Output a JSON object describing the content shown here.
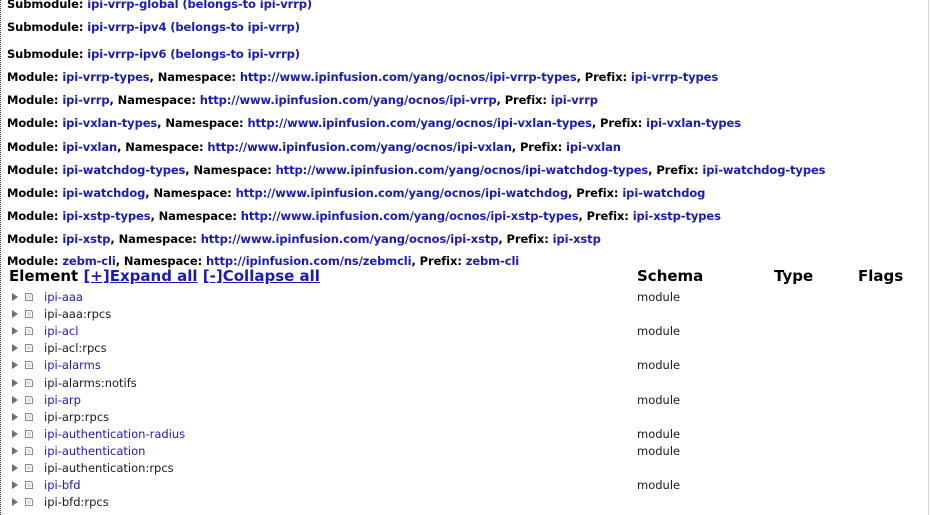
{
  "module_lines": [
    {
      "k1": "Submodule: ",
      "v1": "ipi-vrrp-global (belongs-to ipi-vrrp)"
    },
    {
      "k1": "Submodule: ",
      "v1": "ipi-vrrp-ipv4 (belongs-to ipi-vrrp)"
    },
    {
      "k1": "Submodule: ",
      "v1": "ipi-vrrp-ipv6 (belongs-to ipi-vrrp)"
    },
    {
      "k1": "Module: ",
      "v1": "ipi-vrrp-types",
      "k2": ", Namespace: ",
      "v2": "http://www.ipinfusion.com/yang/ocnos/ipi-vrrp-types",
      "k3": ", Prefix: ",
      "v3": "ipi-vrrp-types"
    },
    {
      "k1": "Module: ",
      "v1": "ipi-vrrp",
      "k2": ", Namespace: ",
      "v2": "http://www.ipinfusion.com/yang/ocnos/ipi-vrrp",
      "k3": ", Prefix: ",
      "v3": "ipi-vrrp"
    },
    {
      "k1": "Module: ",
      "v1": "ipi-vxlan-types",
      "k2": ", Namespace: ",
      "v2": "http://www.ipinfusion.com/yang/ocnos/ipi-vxlan-types",
      "k3": ", Prefix: ",
      "v3": "ipi-vxlan-types"
    },
    {
      "k1": "Module: ",
      "v1": "ipi-vxlan",
      "k2": ", Namespace: ",
      "v2": "http://www.ipinfusion.com/yang/ocnos/ipi-vxlan",
      "k3": ", Prefix: ",
      "v3": "ipi-vxlan"
    },
    {
      "k1": "Module: ",
      "v1": "ipi-watchdog-types",
      "k2": ", Namespace: ",
      "v2": "http://www.ipinfusion.com/yang/ocnos/ipi-watchdog-types",
      "k3": ", Prefix: ",
      "v3": "ipi-watchdog-types"
    },
    {
      "k1": "Module: ",
      "v1": "ipi-watchdog",
      "k2": ", Namespace: ",
      "v2": "http://www.ipinfusion.com/yang/ocnos/ipi-watchdog",
      "k3": ", Prefix: ",
      "v3": "ipi-watchdog"
    },
    {
      "k1": "Module: ",
      "v1": "ipi-xstp-types",
      "k2": ", Namespace: ",
      "v2": "http://www.ipinfusion.com/yang/ocnos/ipi-xstp-types",
      "k3": ", Prefix: ",
      "v3": "ipi-xstp-types"
    },
    {
      "k1": "Module: ",
      "v1": "ipi-xstp",
      "k2": ", Namespace: ",
      "v2": "http://www.ipinfusion.com/yang/ocnos/ipi-xstp",
      "k3": ", Prefix: ",
      "v3": "ipi-xstp"
    },
    {
      "k1": "Module: ",
      "v1": "zebm-cli",
      "k2": ", Namespace: ",
      "v2": "http://ipinfusion.com/ns/zebmcli",
      "k3": ", Prefix: ",
      "v3": "zebm-cli"
    }
  ],
  "header": {
    "element_label": "Element",
    "expand_all": "[+]Expand all",
    "collapse_all": "[-]Collapse all",
    "schema": "Schema",
    "type": "Type",
    "flags": "Flags"
  },
  "tree_rows": [
    {
      "name": "ipi-aaa",
      "link": true,
      "schema": "module"
    },
    {
      "name": "ipi-aaa:rpcs",
      "link": false,
      "schema": ""
    },
    {
      "name": "ipi-acl",
      "link": true,
      "schema": "module"
    },
    {
      "name": "ipi-acl:rpcs",
      "link": false,
      "schema": ""
    },
    {
      "name": "ipi-alarms",
      "link": true,
      "schema": "module"
    },
    {
      "name": "ipi-alarms:notifs",
      "link": false,
      "schema": ""
    },
    {
      "name": "ipi-arp",
      "link": true,
      "schema": "module"
    },
    {
      "name": "ipi-arp:rpcs",
      "link": false,
      "schema": ""
    },
    {
      "name": "ipi-authentication-radius",
      "link": true,
      "schema": "module"
    },
    {
      "name": "ipi-authentication",
      "link": true,
      "schema": "module"
    },
    {
      "name": "ipi-authentication:rpcs",
      "link": false,
      "schema": ""
    },
    {
      "name": "ipi-bfd",
      "link": true,
      "schema": "module"
    },
    {
      "name": "ipi-bfd:rpcs",
      "link": false,
      "schema": ""
    }
  ],
  "icons": {
    "toggle": "triangle-right-icon",
    "node": "folder-icon"
  }
}
